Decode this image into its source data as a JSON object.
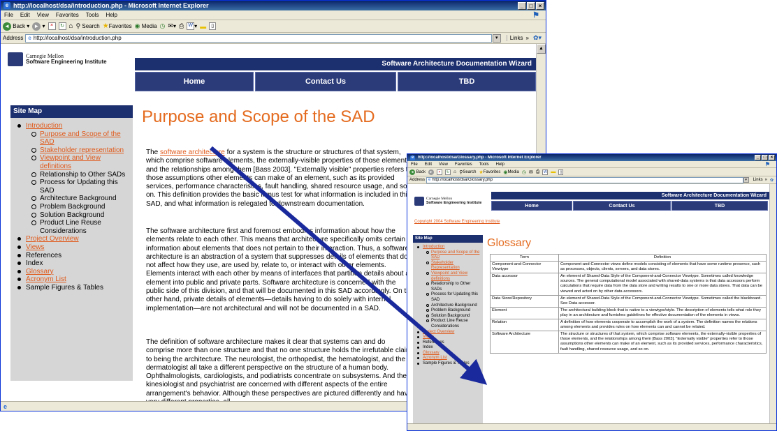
{
  "win1": {
    "title": "http://localhost/dsa/introduction.php - Microsoft Internet Explorer",
    "menu": [
      "File",
      "Edit",
      "View",
      "Favorites",
      "Tools",
      "Help"
    ],
    "toolbar": {
      "back": "Back",
      "search": "Search",
      "favorites": "Favorites",
      "media": "Media"
    },
    "address_label": "Address",
    "address": "http://localhost/dsa/introduction.php",
    "links": "Links",
    "banner": "Software Architecture Documentation Wizard",
    "nav": [
      "Home",
      "Contact Us",
      "TBD"
    ],
    "logo": {
      "line1": "Carnegie Mellon",
      "line2": "Software Engineering Institute"
    },
    "sitemap": {
      "title": "Site Map",
      "items": [
        {
          "label": "Introduction",
          "link": true,
          "sub": [
            {
              "label": "Purpose and Scope of the SAD",
              "link": true
            },
            {
              "label": "Stakeholder representation",
              "link": true
            },
            {
              "label": "Viewpoint and View definitions",
              "link": true
            },
            {
              "label": "Relationship to Other SADs",
              "link": false
            },
            {
              "label": "Process for Updating this SAD",
              "link": false
            },
            {
              "label": "Architecture Background",
              "link": false
            },
            {
              "label": "Problem Background",
              "link": false
            },
            {
              "label": "Solution Background",
              "link": false
            },
            {
              "label": "Product Line Reuse Considerations",
              "link": false
            }
          ]
        },
        {
          "label": "Project Overview",
          "link": true
        },
        {
          "label": "Views",
          "link": true
        },
        {
          "label": "References",
          "link": false
        },
        {
          "label": "Index",
          "link": false
        },
        {
          "label": "Glossary",
          "link": true
        },
        {
          "label": "Acronym List",
          "link": true
        },
        {
          "label": "Sample Figures & Tables",
          "link": false
        }
      ]
    },
    "heading": "Purpose and Scope of the SAD",
    "p1_pre": "The ",
    "p1_link": "software architecture",
    "p1_post": " for a system is the structure or structures of that system, which comprise software elements, the externally-visible properties of those elements, and the relationships among them [Bass 2003]. \"Externally visible\" properties refers to those assumptions other elements can make of an element, such as its provided services, performance characteristics, fault handling, shared resource usage, and so on. This definition provides the basic litmus test for what information is included in this SAD, and what information is relegated to downstream documentation.",
    "p2": "The software architecture first and foremost embodies information about how the elements relate to each other. This means that architecture specifically omits certain information about elements that does not pertain to their interaction. Thus, a software architecture is an abstraction of a system that suppresses details of elements that do not affect how they use, are used by, relate to, or interact with other elements. Elements interact with each other by means of interfaces that partition details about an element into public and private parts. Software architecture is concerned with the public side of this division, and that will be documented in this SAD accordingly. On the other hand, private details of elements—details having to do solely with internal implementation—are not architectural and will not be documented in a SAD.",
    "p3": "The definition of software architecture makes it clear that systems can and do comprise more than one structure and that no one structure holds the irrefutable claim to being the architecture. The neurologist, the orthopedist, the hematologist, and the dermatologist all take a different perspective on the structure of a human body. Ophthalmologists, cardiologists, and podiatrists concentrate on subsystems. And the kinesiologist and psychiatrist are concerned with different aspects of the entire arrangement's behavior. Although these perspectives are pictured differently and have very different properties, all"
  },
  "win2": {
    "title": "http://localhost/dsa/Glossary.php - Microsoft Internet Explorer",
    "menu": [
      "File",
      "Edit",
      "View",
      "Favorites",
      "Tools",
      "Help"
    ],
    "address_label": "Address",
    "address": "http://localhost/dsa/Glossary.php",
    "links": "Links",
    "banner": "Software Architecture Documentation Wizard",
    "nav": [
      "Home",
      "Contact Us",
      "TBD"
    ],
    "logo": {
      "line1": "Carnegie Mellon",
      "line2": "Software Engineering Institute"
    },
    "copyright": "Copyright 2004 Software Engineering Institute",
    "sitemap": {
      "title": "Site Map",
      "items": [
        {
          "label": "Introduction",
          "link": true,
          "sub": [
            {
              "label": "Purpose and Scope of the SAD",
              "link": true
            },
            {
              "label": "Stakeholder Representation",
              "link": true
            },
            {
              "label": "Viewpoint and View definitions",
              "link": true
            },
            {
              "label": "Relationship to Other SADs",
              "link": false
            },
            {
              "label": "Process for Updating this SAD",
              "link": false
            },
            {
              "label": "Architecture Background",
              "link": false
            },
            {
              "label": "Problem Background",
              "link": false
            },
            {
              "label": "Solution Background",
              "link": false
            },
            {
              "label": "Product Line Reuse Considerations",
              "link": false
            }
          ]
        },
        {
          "label": "Project Overview",
          "link": true
        },
        {
          "label": "Views",
          "link": true
        },
        {
          "label": "References",
          "link": false
        },
        {
          "label": "Index",
          "link": false
        },
        {
          "label": "Glossary",
          "link": true
        },
        {
          "label": "Acronym List",
          "link": true
        },
        {
          "label": "Sample Figures & Tables",
          "link": false
        }
      ]
    },
    "heading": "Glossary",
    "table": {
      "headers": [
        "Term",
        "Definition"
      ],
      "rows": [
        [
          "Component-and-Connector Viewtype",
          "Component-and-Connector views define models consisting of elements that have some runtime presence, such as processes, objects, clients, servers, and data stores."
        ],
        [
          "Data accessor",
          "An element of Shared-Data Style of the Component-and-Connector Viewtype. Sometimes called knowledge sources. The general computational model associated with shared-data systems is that data accessors perform calculations that require data from the data store and writing results to one or more data stores. That data can be viewed and acted on by other data accessors."
        ],
        [
          "Data Store/Repository",
          "An element of Shared-Data Style of the Component-and-Connector Viewtype. Sometimes called the blackboard. See Data accessor."
        ],
        [
          "Element",
          "The architectural building block that is native to a viewtype/style. The description of elements tells what role they play in an architecture and furnishes guidelines for effective documentation of the elements in views."
        ],
        [
          "Relation",
          "A definition of how elements cooperate to accomplish the work of a system. The definition names the relations among elements and provides rules on how elements can and cannot be related."
        ],
        [
          "Software Architecture",
          "The structure or structures of that system, which comprise software elements, the externally-visible properties of those elements, and the relationships among them [Bass 2003]. \"Externally visible\" properties refer to those assumptions other elements can make of an element, such as its provided services, performance characteristics, fault handling, shared resource usage, and so on."
        ]
      ]
    }
  },
  "colors": {
    "accent": "#e46b1f",
    "banner": "#1c2f6e",
    "arrow": "#1a2a9c"
  }
}
